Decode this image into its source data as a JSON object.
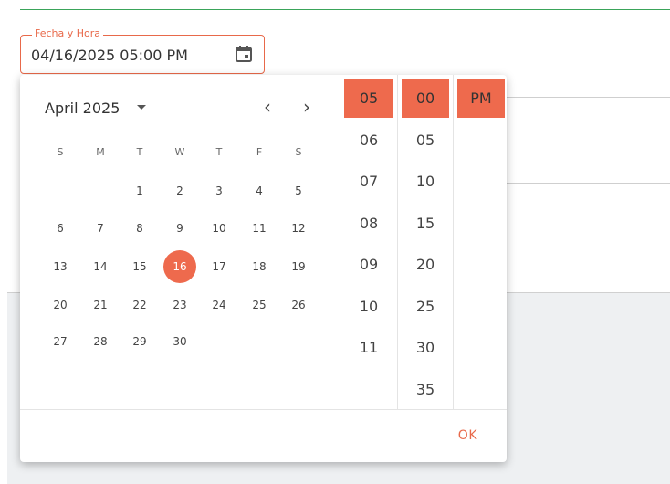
{
  "field": {
    "label": "Fecha y Hora",
    "value": "04/16/2025 05:00 PM"
  },
  "calendar": {
    "month_label": "April 2025",
    "prev_glyph": "‹",
    "next_glyph": "›",
    "weekdays": [
      "S",
      "M",
      "T",
      "W",
      "T",
      "F",
      "S"
    ],
    "weeks": [
      [
        "",
        "",
        "1",
        "2",
        "3",
        "4",
        "5"
      ],
      [
        "6",
        "7",
        "8",
        "9",
        "10",
        "11",
        "12"
      ],
      [
        "13",
        "14",
        "15",
        "16",
        "17",
        "18",
        "19"
      ],
      [
        "20",
        "21",
        "22",
        "23",
        "24",
        "25",
        "26"
      ],
      [
        "27",
        "28",
        "29",
        "30",
        "",
        "",
        ""
      ]
    ],
    "selected_day": "16"
  },
  "time": {
    "hours": [
      "05",
      "06",
      "07",
      "08",
      "09",
      "10",
      "11"
    ],
    "minutes": [
      "00",
      "05",
      "10",
      "15",
      "20",
      "25",
      "30",
      "35"
    ],
    "meridiem": [
      "PM"
    ],
    "selected_hour": "05",
    "selected_minute": "00",
    "selected_meridiem": "PM"
  },
  "footer": {
    "ok_label": "OK"
  },
  "colors": {
    "accent": "#ee6a4d",
    "label_accent": "#e8694a",
    "green_line": "#3aa45a"
  },
  "icons": {
    "calendar_icon": "calendar-icon",
    "dropdown_icon": "caret-down-icon"
  }
}
